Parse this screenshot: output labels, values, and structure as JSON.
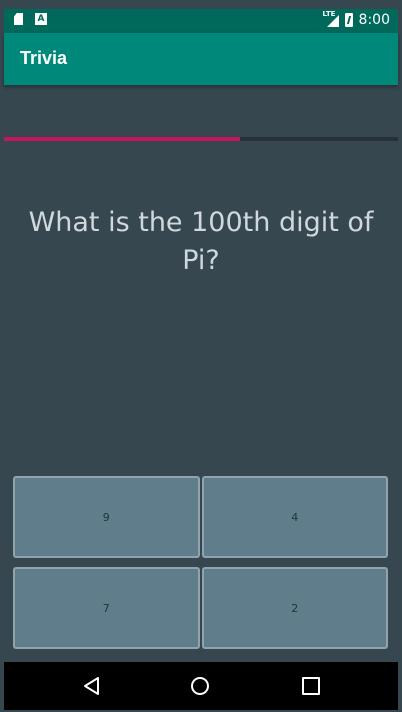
{
  "status_bar": {
    "time": "8:00",
    "network": "LTE",
    "icons": [
      "sd-card-icon",
      "a-notification-icon",
      "lte-signal-icon",
      "battery-charging-icon"
    ]
  },
  "app_bar": {
    "title": "Trivia"
  },
  "progress": {
    "fraction": 0.6,
    "color": "#c2185b"
  },
  "question": {
    "text": "What is the 100th digit of Pi?"
  },
  "answers": [
    {
      "label": "9"
    },
    {
      "label": "4"
    },
    {
      "label": "7"
    },
    {
      "label": "2"
    }
  ],
  "nav_bar": {
    "icons": [
      "back-icon",
      "home-icon",
      "recents-icon"
    ]
  },
  "colors": {
    "status_bar": "#00695c",
    "app_bar": "#00897b",
    "background": "#37474f",
    "answer_button": "#607d8b",
    "accent": "#c2185b"
  }
}
